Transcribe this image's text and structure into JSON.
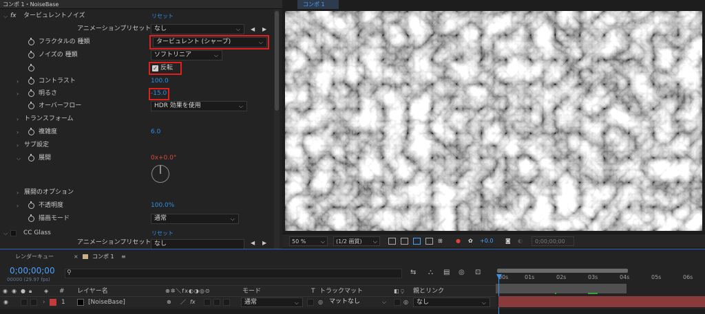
{
  "effect_controls": {
    "header_title": "コンポ 1・NoiseBase",
    "effect_name": "タービュレントノイズ",
    "reset_label": "リセット",
    "preset_label": "アニメーションプリセット",
    "preset_value": "なし",
    "fractal_type_label": "フラクタルの 種類",
    "fractal_type_value": "タービュレント (シャープ)",
    "noise_type_label": "ノイズの 種類",
    "noise_type_value": "ソフトリニア",
    "invert_label": "反転",
    "contrast_label": "コントラスト",
    "contrast_value": "100.0",
    "brightness_label": "明るさ",
    "brightness_value": "-15.0",
    "overflow_label": "オーバーフロー",
    "overflow_value": "HDR 効果を使用",
    "transform_label": "トランスフォーム",
    "complexity_label": "複雑度",
    "complexity_value": "6.0",
    "sub_label": "サブ設定",
    "evolution_label": "展開",
    "evolution_value": "0x+0.0°",
    "evolution_options_label": "展開のオプション",
    "opacity_label": "不透明度",
    "opacity_value": "100.0%",
    "blend_label": "描画モード",
    "blend_value": "通常",
    "cc_glass_label": "CC Glass",
    "cc_reset_label": "リセット",
    "cc_preset_label": "アニメーションプリセット",
    "cc_preset_value": "なし"
  },
  "viewer": {
    "tab_label": "コンポ 1",
    "zoom": "50 %",
    "resolution": "(1/2 画質)",
    "exposure": "+0.0",
    "timecode": "0;00;00;00"
  },
  "timeline": {
    "render_queue_tab": "レンダーキュー",
    "comp_tab": "コンポ 1",
    "current_time": "0;00;00;00",
    "frame_info": "00000 (29.97 fps)",
    "search_placeholder": "",
    "ruler": [
      "00s",
      "01s",
      "02s",
      "03s",
      "04s",
      "05s",
      "06s"
    ],
    "col_hash": "#",
    "col_layer_name": "レイヤー名",
    "col_mode": "モード",
    "col_t": "T",
    "col_track_matte": "トラックマット",
    "col_parent": "親とリンク",
    "layer_index": "1",
    "layer_name": "[NoiseBase]",
    "layer_mode": "通常",
    "layer_matte": "マットなし",
    "layer_parent": "なし"
  },
  "colors": {
    "accent": "#2e90e8",
    "highlight_box": "#e0201f",
    "layer_bar": "#8a3a3a"
  }
}
